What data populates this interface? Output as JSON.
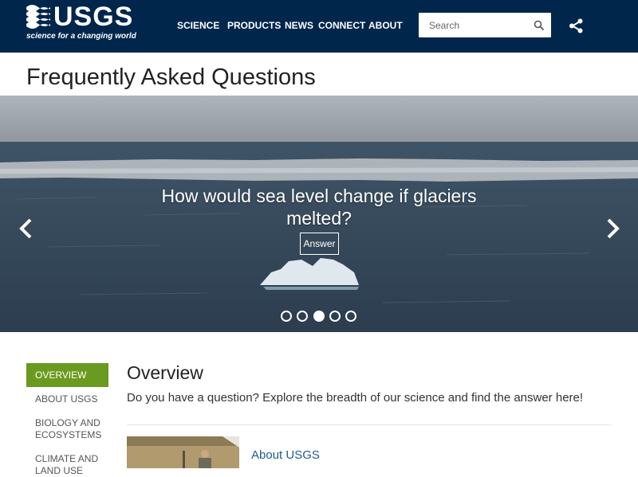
{
  "header": {
    "logo_text": "USGS",
    "logo_tagline": "science for a changing world",
    "nav": [
      {
        "label": "SCIENCE"
      },
      {
        "label": "PRODUCTS"
      },
      {
        "label": "NEWS"
      },
      {
        "label": "CONNECT"
      },
      {
        "label": "ABOUT"
      }
    ],
    "search": {
      "placeholder": "Search",
      "icon": "search-icon"
    },
    "share_icon": "share-icon",
    "colors": {
      "background": "#00264c"
    }
  },
  "page_title": "Frequently Asked Questions",
  "carousel": {
    "question": "How would sea level change if glaciers melted?",
    "answer_label": "Answer",
    "slide_count": 5,
    "active_index": 2,
    "prev_icon": "chevron-left-icon",
    "next_icon": "chevron-right-icon"
  },
  "sidebar": {
    "items": [
      {
        "label": "OVERVIEW",
        "active": true
      },
      {
        "label": "ABOUT USGS",
        "active": false
      },
      {
        "label": "BIOLOGY AND ECOSYSTEMS",
        "active": false
      },
      {
        "label": "CLIMATE AND LAND USE",
        "active": false
      }
    ],
    "active_color": "#6a9a1f"
  },
  "main": {
    "heading": "Overview",
    "description": "Do you have a question? Explore the breadth of our science and find the answer here!",
    "cards": [
      {
        "title": "About USGS"
      }
    ],
    "link_color": "#1f5a96"
  }
}
